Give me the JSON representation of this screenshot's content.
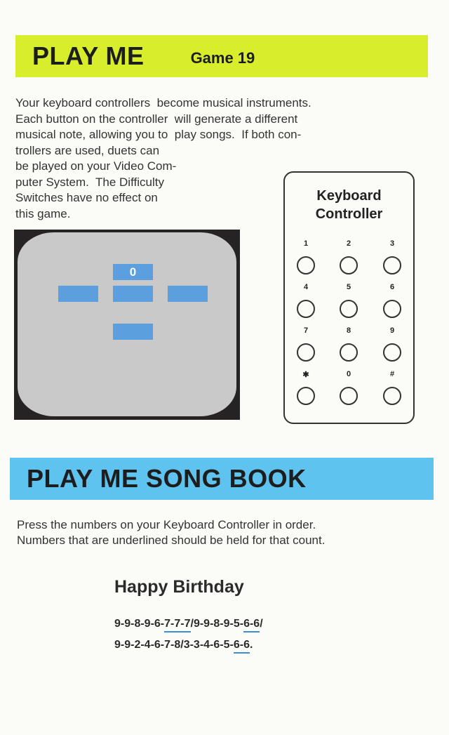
{
  "header": {
    "title": "PLAY ME",
    "game": "Game 19"
  },
  "description": [
    "Your keyboard controllers  become musical instruments.",
    "Each button on the controller  will generate a different",
    "musical note, allowing you to  play songs.  If both con-",
    "trollers are used, duets can",
    "be played on your Video Com-",
    "puter System.  The Difficulty",
    "Switches have no effect on",
    "this game."
  ],
  "screen": {
    "tile_label": "0",
    "tile_color": "#5b9fdf",
    "screen_color": "#c9c9c9"
  },
  "keypad": {
    "title_line1": "Keyboard",
    "title_line2": "Controller",
    "keys": [
      "1",
      "2",
      "3",
      "4",
      "5",
      "6",
      "7",
      "8",
      "9",
      "✱",
      "0",
      "#"
    ]
  },
  "songbook": {
    "title": "PLAY ME SONG BOOK",
    "instructions": [
      "Press the numbers on your Keyboard Controller in order.",
      "Numbers that are underlined should be held for that count."
    ],
    "song_title": "Happy Birthday",
    "line1": {
      "a": "9-9-8-9-6-",
      "b": "7-7-7",
      "c": "/9-9-8-9-5-",
      "d": "6-6",
      "e": "/"
    },
    "line2": {
      "a": "9-9-2-4-6-7-8/3-3-4-6-5-",
      "b": "6-6",
      "c": "."
    }
  },
  "colors": {
    "green_banner": "#d8ee2c",
    "blue_banner": "#5ec3ee",
    "underline": "#3a90d8"
  }
}
